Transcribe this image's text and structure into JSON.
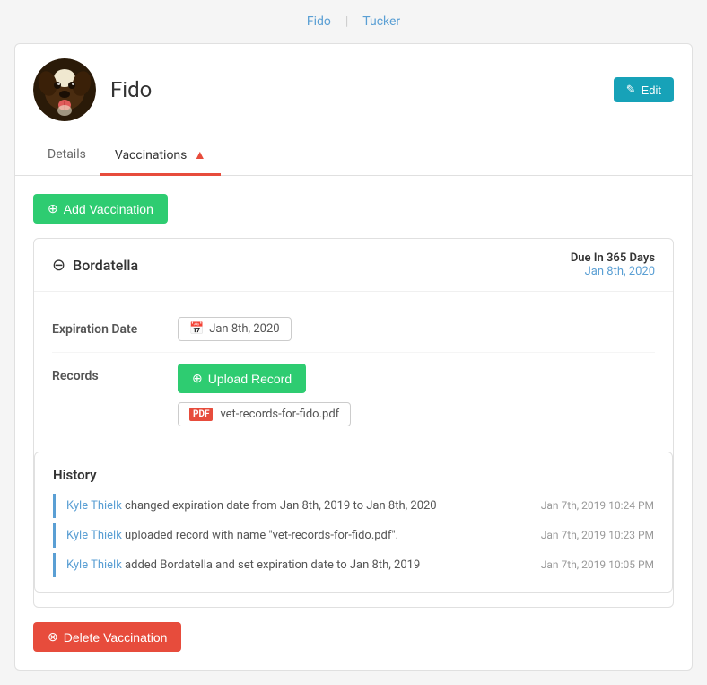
{
  "topNav": {
    "links": [
      {
        "label": "Fido",
        "active": true
      },
      {
        "label": "Tucker",
        "active": false
      }
    ]
  },
  "profile": {
    "name": "Fido",
    "editLabel": "Edit"
  },
  "tabs": [
    {
      "label": "Details",
      "active": false,
      "hasWarning": false
    },
    {
      "label": "Vaccinations",
      "active": true,
      "hasWarning": true
    }
  ],
  "addVaccinationLabel": "+ Add Vaccination",
  "vaccination": {
    "name": "Bordatella",
    "dueLabel": "Due In 365 Days",
    "dueDate": "Jan 8th, 2020",
    "expirationLabel": "Expiration Date",
    "expirationValue": "Jan 8th, 2020",
    "recordsLabel": "Records",
    "uploadRecordLabel": "Upload Record",
    "file": {
      "name": "vet-records-for-fido.pdf"
    }
  },
  "history": {
    "title": "History",
    "items": [
      {
        "actor": "Kyle Thielk",
        "text": " changed expiration date from Jan 8th, 2019 to Jan 8th, 2020",
        "timestamp": "Jan 7th, 2019 10:24 PM"
      },
      {
        "actor": "Kyle Thielk",
        "text": " uploaded record with name \"vet-records-for-fido.pdf\".",
        "timestamp": "Jan 7th, 2019 10:23 PM"
      },
      {
        "actor": "Kyle Thielk",
        "text": " added Bordatella and set expiration date to Jan 8th, 2019",
        "timestamp": "Jan 7th, 2019 10:05 PM"
      }
    ]
  },
  "deleteLabel": "Delete Vaccination"
}
